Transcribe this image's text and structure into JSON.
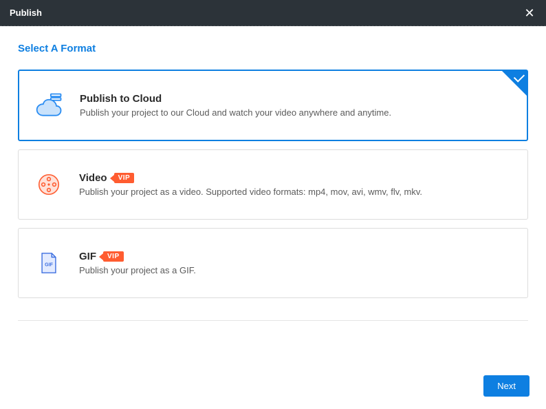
{
  "titlebar": {
    "title": "Publish"
  },
  "heading": "Select A Format",
  "options": {
    "cloud": {
      "title": "Publish to Cloud",
      "desc": "Publish your project to our Cloud and watch your video anywhere and anytime."
    },
    "video": {
      "title": "Video",
      "vip": "VIP",
      "desc": "Publish your project as a video. Supported video formats: mp4, mov, avi, wmv, flv, mkv."
    },
    "gif": {
      "title": "GIF",
      "vip": "VIP",
      "icon_text": "GIF",
      "desc": "Publish your project as a GIF."
    }
  },
  "footer": {
    "next": "Next"
  }
}
